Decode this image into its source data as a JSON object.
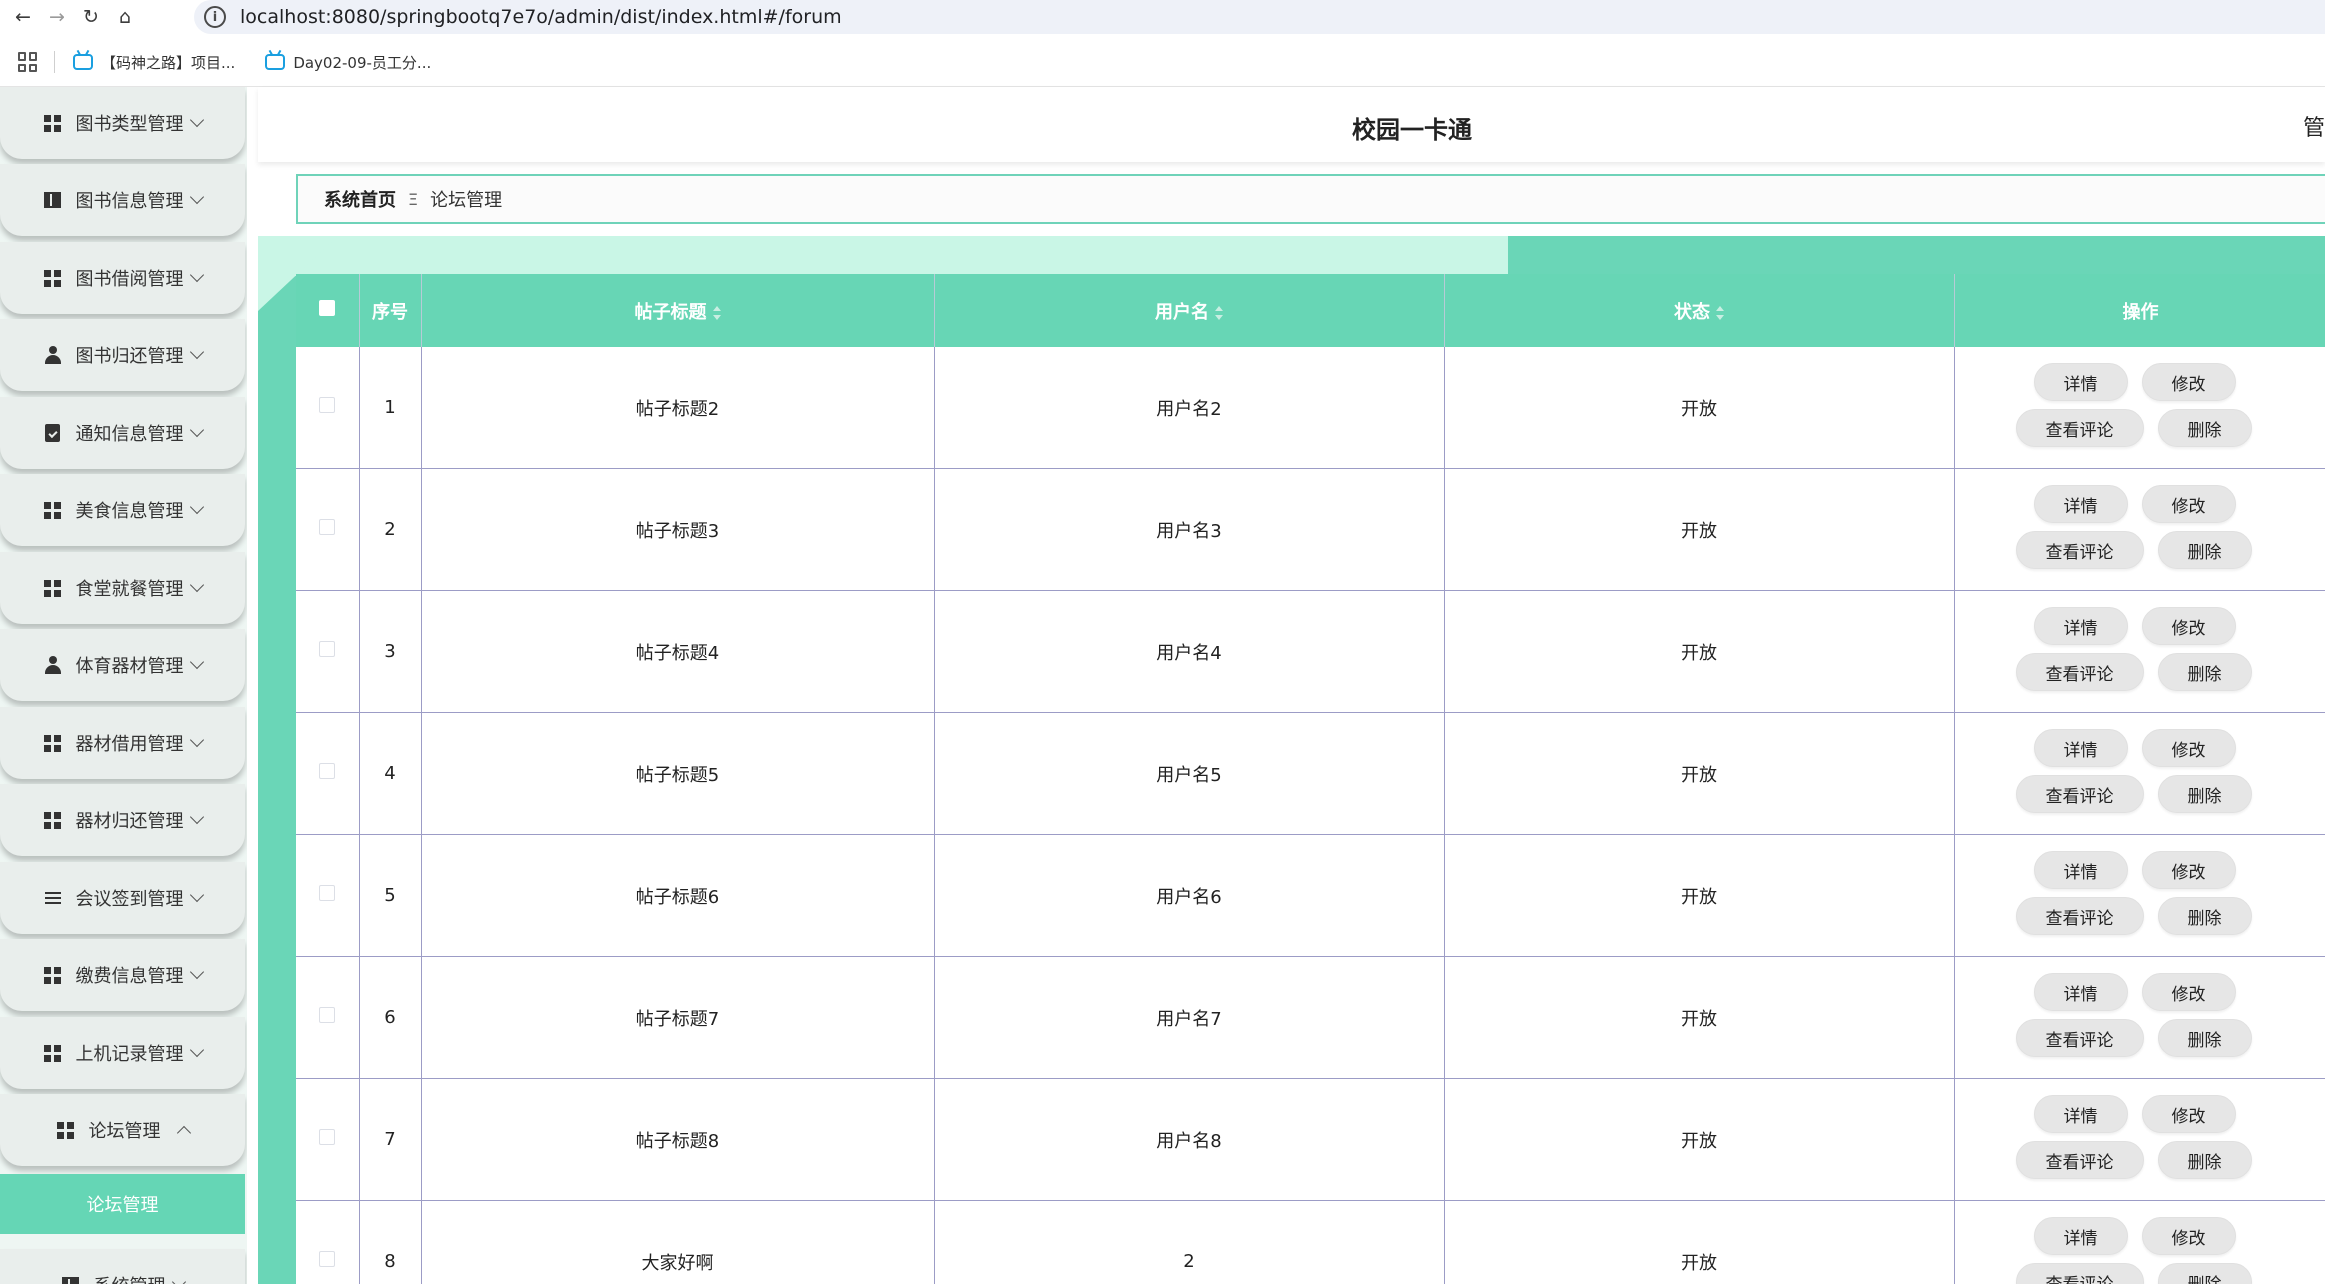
{
  "browser": {
    "url": "localhost:8080/springbootq7e7o/admin/dist/index.html#/forum",
    "bookmarks": [
      "【码神之路】项目...",
      "Day02-09-员工分..."
    ]
  },
  "header": {
    "title": "校园一卡通",
    "right_text": "管"
  },
  "breadcrumb": {
    "home": "系统首页",
    "separator": "Ξ",
    "current": "论坛管理"
  },
  "sidebar": {
    "items": [
      {
        "label": "图书类型管理",
        "icon": "grid-icon"
      },
      {
        "label": "图书信息管理",
        "icon": "book-icon"
      },
      {
        "label": "图书借阅管理",
        "icon": "grid-icon"
      },
      {
        "label": "图书归还管理",
        "icon": "user-icon"
      },
      {
        "label": "通知信息管理",
        "icon": "clipboard-check-icon"
      },
      {
        "label": "美食信息管理",
        "icon": "grid-icon"
      },
      {
        "label": "食堂就餐管理",
        "icon": "grid-icon"
      },
      {
        "label": "体育器材管理",
        "icon": "user-icon"
      },
      {
        "label": "器材借用管理",
        "icon": "grid-icon"
      },
      {
        "label": "器材归还管理",
        "icon": "grid-icon"
      },
      {
        "label": "会议签到管理",
        "icon": "list-icon"
      },
      {
        "label": "缴费信息管理",
        "icon": "grid-icon"
      },
      {
        "label": "上机记录管理",
        "icon": "grid-icon"
      },
      {
        "label": "论坛管理",
        "icon": "grid-icon",
        "expanded": true
      }
    ],
    "active_submenu": "论坛管理",
    "partial_item": "系统管理"
  },
  "table": {
    "headers": {
      "index": "序号",
      "title": "帖子标题",
      "username": "用户名",
      "status": "状态",
      "ops": "操作"
    },
    "buttons": {
      "detail": "详情",
      "edit": "修改",
      "comments": "查看评论",
      "delete": "删除"
    },
    "rows": [
      {
        "index": "1",
        "title": "帖子标题2",
        "username": "用户名2",
        "status": "开放"
      },
      {
        "index": "2",
        "title": "帖子标题3",
        "username": "用户名3",
        "status": "开放"
      },
      {
        "index": "3",
        "title": "帖子标题4",
        "username": "用户名4",
        "status": "开放"
      },
      {
        "index": "4",
        "title": "帖子标题5",
        "username": "用户名5",
        "status": "开放"
      },
      {
        "index": "5",
        "title": "帖子标题6",
        "username": "用户名6",
        "status": "开放"
      },
      {
        "index": "6",
        "title": "帖子标题7",
        "username": "用户名7",
        "status": "开放"
      },
      {
        "index": "7",
        "title": "帖子标题8",
        "username": "用户名8",
        "status": "开放"
      },
      {
        "index": "8",
        "title": "大家好啊",
        "username": "2",
        "status": "开放"
      }
    ]
  },
  "colors": {
    "accent": "#67d6b5",
    "accent_light": "#c9f6e6",
    "row_border": "#9c9cc6"
  }
}
